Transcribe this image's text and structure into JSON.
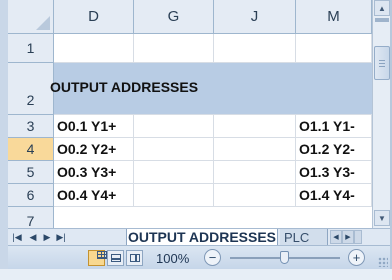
{
  "columns": [
    "D",
    "G",
    "J",
    "M"
  ],
  "rows": [
    "1",
    "2",
    "3",
    "4",
    "5",
    "6",
    "7"
  ],
  "active_row": "4",
  "header_cell": "OUTPUT ADDRESSES",
  "cells": {
    "d3": "O0.1 Y1+",
    "m3": "O1.1 Y1-",
    "d4": "O0.2 Y2+",
    "m4": "O1.2 Y2-",
    "d5": "O0.3 Y3+",
    "m5": "O1.3 Y3-",
    "d6": "O0.4 Y4+",
    "m6": "O1.4 Y4-"
  },
  "tabs": {
    "active": "OUTPUT ADDRESSES",
    "next": "PLC"
  },
  "status": {
    "zoom": "100%",
    "zoom_out": "−",
    "zoom_in": "+"
  },
  "colors": {
    "band": "#b8cce4",
    "active_row_header": "#f9d99a",
    "header_bg": "#e4ebf4"
  }
}
